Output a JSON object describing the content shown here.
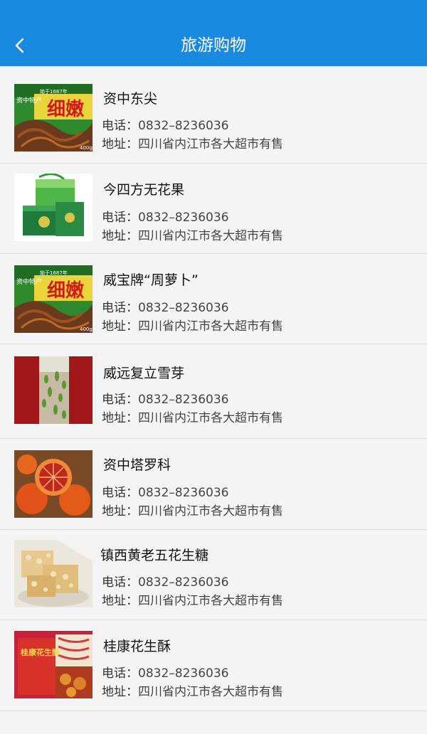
{
  "header": {
    "title": "旅游购物"
  },
  "phone_label": "电话：",
  "address_label": "地址：",
  "items": [
    {
      "name": "资中东尖",
      "phone": "0832–8236036",
      "address": "四川省内江市各大超市有售",
      "image": "box-noodle-icon",
      "img_text": {
        "brand": "资中特产",
        "headline": "细嫩",
        "tag": "始于1687年",
        "weight": "400g"
      }
    },
    {
      "name": "今四方无花果",
      "phone": "0832–8236036",
      "address": "四川省内江市各大超市有售",
      "image": "gift-bag-icon"
    },
    {
      "name": "威宝牌“周萝卜”",
      "phone": "0832–8236036",
      "address": "四川省内江市各大超市有售",
      "image": "box-noodle-icon",
      "img_text": {
        "brand": "资中特产",
        "headline": "细嫩",
        "tag": "始于1687年",
        "weight": "400g"
      }
    },
    {
      "name": "威远复立雪芽",
      "phone": "0832–8236036",
      "address": "四川省内江市各大超市有售",
      "image": "tea-glass-icon"
    },
    {
      "name": "资中塔罗科",
      "phone": "0832–8236036",
      "address": "四川省内江市各大超市有售",
      "image": "orange-icon"
    },
    {
      "name": "镇西黄老五花生糖",
      "phone": "0832–8236036",
      "address": "四川省内江市各大超市有售",
      "image": "peanut-candy-icon"
    },
    {
      "name": "桂康花生酥",
      "phone": "0832–8236036",
      "address": "四川省内江市各大超市有售",
      "image": "peanut-box-icon",
      "img_text": {
        "headline": "桂康花生酥"
      }
    }
  ]
}
